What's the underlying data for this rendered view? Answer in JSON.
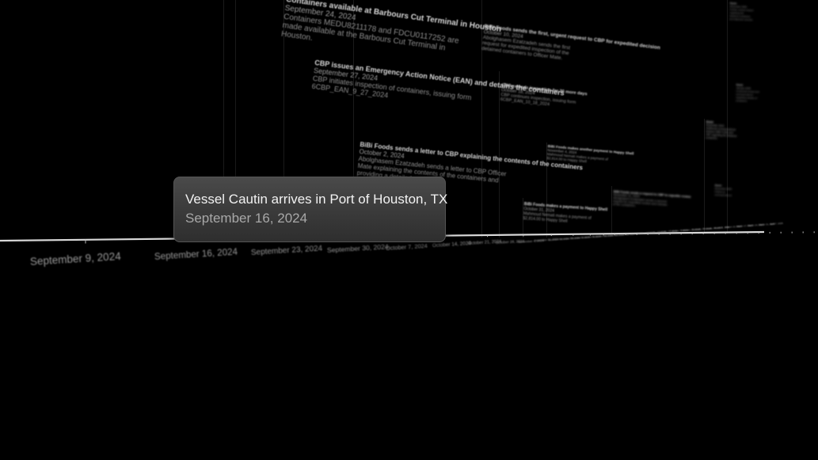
{
  "events": [
    {
      "title": "Containers available at Barbours Cut Terminal in Houston",
      "date": "September 24, 2024",
      "desc": "Containers MEDU8211178 and FDCU0117252 are made available at the Barbours Cut Terminal in Houston."
    },
    {
      "title": "CBP issues an Emergency Action Notice (EAN) and detains the containers",
      "date": "September 27, 2024",
      "desc": "CBP initiates inspection of containers, issuing form 6CBP_EAN_9_27_2024"
    },
    {
      "title": "BiBi Foods sends a letter to CBP explaining the contents of the containers",
      "date": "October 2, 2024",
      "desc": "Abolghasem Ezatzadeh sends a letter to CBP Officer Mate explaining the contents of the containers and providing a detailed packing list."
    },
    {
      "title": "BiBi Foods sends the first, urgent request to CBP for expedited decision",
      "date": "October 10, 2024",
      "desc": "Abolghasem Ezatzadeh sends the first request for expedited inspection of the detained containers to Officer Mate."
    },
    {
      "title": "CBP extends inspection for 30 more days",
      "date": "October 18, 2024",
      "desc": "CBP continues inspection, issuing form 6CBP_EAN_10_18_2024"
    },
    {
      "title": "BiBi Foods makes a payment to Happy Shell",
      "date": "October 31, 2024",
      "desc": "Mahmoud Nemati makes a payment of $2,814.00 to Happy Shell"
    },
    {
      "title": "BiBi Foods makes another payment to Happy Shell",
      "date": "November 4, 2024",
      "desc": "Mahmoud Nemati makes a payment of $2,814.00 to Happy Shell"
    },
    {
      "title": "BiBi Foods sends a request to CBP to expedite review",
      "date": "November 11, 2024",
      "desc": "Abolghasem Ezatzadeh sends a second request for expedited review and release of the containers."
    },
    {
      "title": "Event",
      "date": "November 2024",
      "desc": "Additional correspondence between BiBi Foods and CBP regarding the detained containers."
    },
    {
      "title": "Event",
      "date": "December 2024",
      "desc": "Further notices issued regarding the detained containers and shipment records."
    },
    {
      "title": "Event",
      "date": "December 2024",
      "desc": "Follow-up correspondence."
    },
    {
      "title": "Event",
      "date": "January 2025",
      "desc": "Continued review and correspondence regarding release of containers."
    }
  ],
  "timeline": {
    "ticks": [
      "September 9, 2024",
      "September 16, 2024",
      "September 23, 2024",
      "September 30, 2024",
      "October 7, 2024",
      "October 14, 2024",
      "October 21, 2024",
      "October 28, 2024",
      "November 4, 2024",
      "November 11, 2024",
      "November 18, 2024",
      "November 25, 2024",
      "December 2, 2024",
      "December 9, 2024",
      "December 16, 2024",
      "December 23, 2024",
      "December 30, 2024",
      "January 6, 2025",
      "January 13, 2025",
      "January 20, 2025",
      "January 27, 2025",
      "February 3, 2025",
      "February 10, 2025",
      "February 17, 2025",
      "February 24, 2025",
      "March 3, 2025",
      "March 10, 2025",
      "March 17, 2025",
      "March 24, 2025",
      "March 31, 2025",
      "April 7, 2025"
    ],
    "axis_color": "#d8d8d8"
  },
  "tooltip": {
    "title": "Vessel Cautin arrives in Port of Houston, TX",
    "date": "September 16, 2024"
  }
}
